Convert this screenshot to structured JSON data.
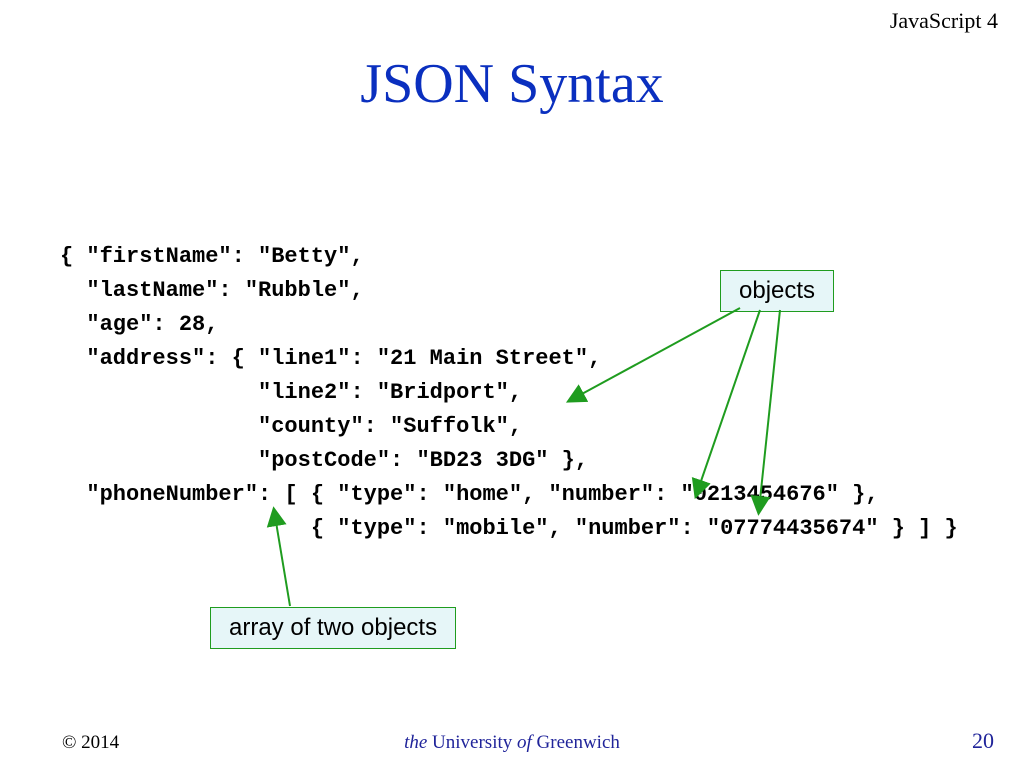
{
  "header": {
    "course": "JavaScript 4"
  },
  "title": "JSON Syntax",
  "code_lines": [
    "{ \"firstName\": \"Betty\",",
    "  \"lastName\": \"Rubble\",",
    "  \"age\": 28,",
    "  \"address\": { \"line1\": \"21 Main Street\",",
    "               \"line2\": \"Bridport\",",
    "               \"county\": \"Suffolk\",",
    "               \"postCode\": \"BD23 3DG\" },",
    "  \"phoneNumber\": [ { \"type\": \"home\", \"number\": \"0213454676\" },",
    "                   { \"type\": \"mobile\", \"number\": \"07774435674\" } ] }"
  ],
  "callouts": {
    "objects": "objects",
    "array": "array of two objects"
  },
  "footer": {
    "copyright": "© 2014",
    "uni_the": "the ",
    "uni_name": "University ",
    "uni_of": "of ",
    "uni_place": "Greenwich",
    "slide": "20"
  },
  "colors": {
    "title": "#0a2fbf",
    "callout_bg": "#e6f6f8",
    "callout_border": "#1f9c1f",
    "arrow": "#1f9c1f",
    "footer_accent": "#20249a"
  }
}
